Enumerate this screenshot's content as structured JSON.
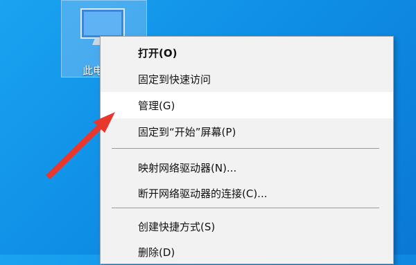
{
  "desktop": {
    "icon_name": "computer-icon",
    "icon_label": "此电"
  },
  "context_menu": {
    "items": [
      {
        "label": "打开(O)",
        "bold": true
      },
      {
        "label": "固定到快速访问"
      },
      {
        "label": "管理(G)",
        "highlighted": true
      },
      {
        "label": "固定到“开始”屏幕(P)"
      },
      {
        "label": "映射网络驱动器(N)..."
      },
      {
        "label": "断开网络驱动器的连接(C)..."
      },
      {
        "label": "创建快捷方式(S)"
      },
      {
        "label": "删除(D)"
      }
    ]
  },
  "colors": {
    "desktop_background": "#0f8fe6",
    "menu_background": "#f2f2f2",
    "menu_highlight": "#ffffff",
    "annotation_arrow": "#e8382e"
  }
}
